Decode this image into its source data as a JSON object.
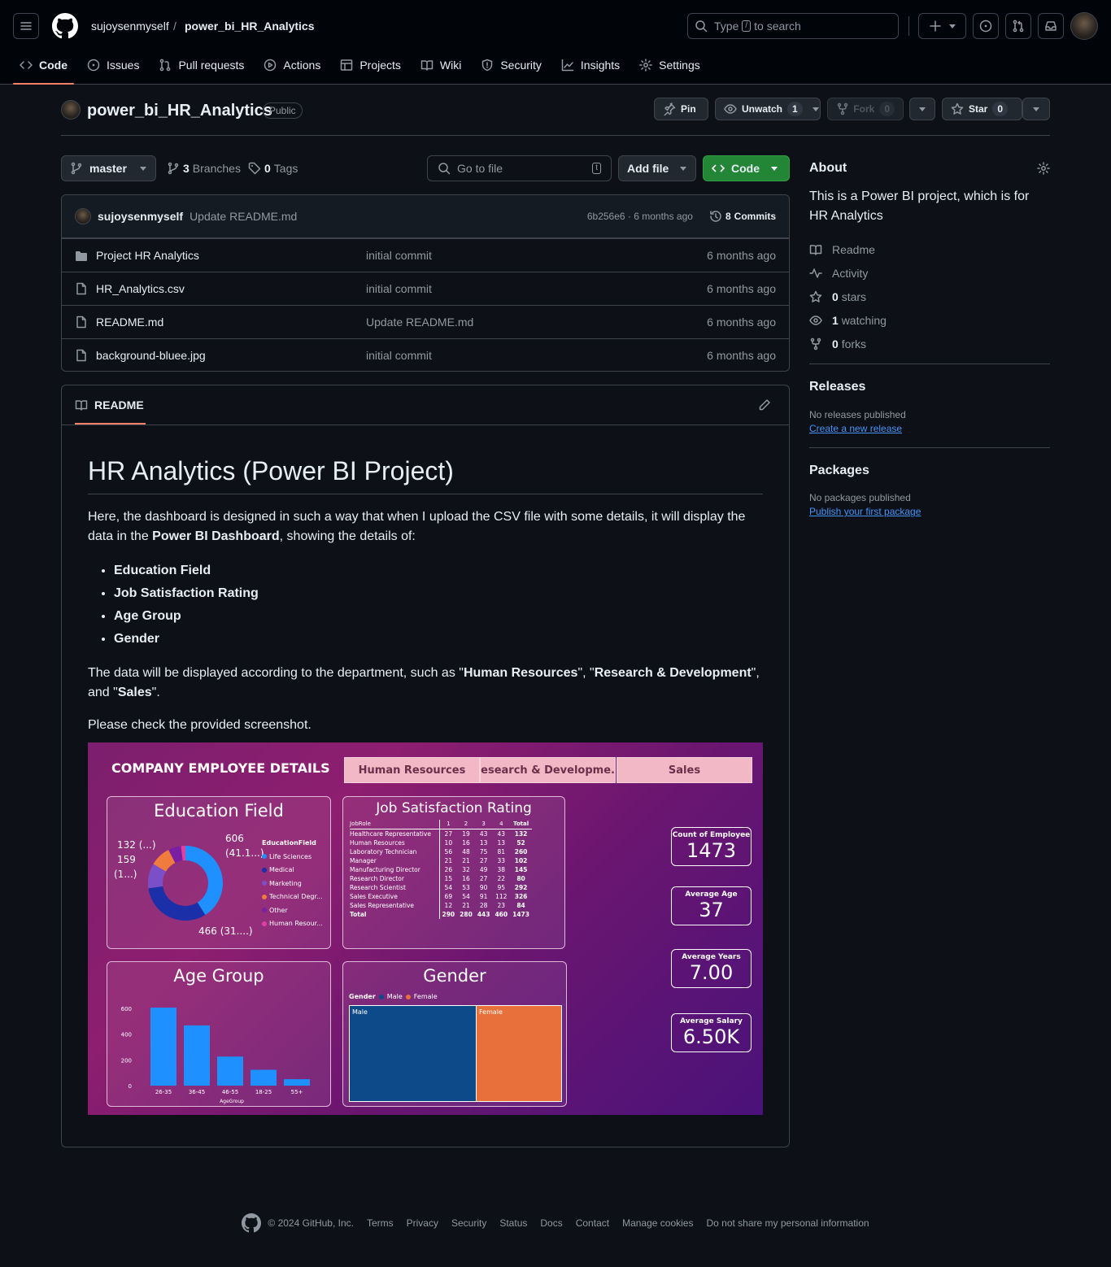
{
  "header": {
    "owner": "sujoysenmyself",
    "repo": "power_bi_HR_Analytics",
    "search_placeholder_a": "Type",
    "search_key": "/",
    "search_placeholder_b": "to search"
  },
  "nav": [
    {
      "label": "Code",
      "icon": "code-icon"
    },
    {
      "label": "Issues",
      "icon": "issue-icon"
    },
    {
      "label": "Pull requests",
      "icon": "pull-request-icon"
    },
    {
      "label": "Actions",
      "icon": "play-icon"
    },
    {
      "label": "Projects",
      "icon": "table-icon"
    },
    {
      "label": "Wiki",
      "icon": "book-icon"
    },
    {
      "label": "Security",
      "icon": "shield-icon"
    },
    {
      "label": "Insights",
      "icon": "graph-icon"
    },
    {
      "label": "Settings",
      "icon": "gear-icon"
    }
  ],
  "repo": {
    "name": "power_bi_HR_Analytics",
    "visibility": "Public",
    "pin": "Pin",
    "unwatch": "Unwatch",
    "watch_count": "1",
    "fork": "Fork",
    "fork_count": "0",
    "star": "Star",
    "star_count": "0"
  },
  "toolbar": {
    "branch": "master",
    "branches_count": "3",
    "branches_label": "Branches",
    "tags_count": "0",
    "tags_label": "Tags",
    "goto_placeholder": "Go to file",
    "goto_key": "t",
    "add_file": "Add file",
    "code": "Code"
  },
  "commit": {
    "author": "sujoysenmyself",
    "message": "Update README.md",
    "hash_time": "6b256e6 · 6 months ago",
    "commits_count": "8",
    "commits_label": "Commits"
  },
  "files": [
    {
      "name": "Project HR Analytics",
      "type": "folder",
      "message": "initial commit",
      "age": "6 months ago"
    },
    {
      "name": "HR_Analytics.csv",
      "type": "file",
      "message": "initial commit",
      "age": "6 months ago"
    },
    {
      "name": "README.md",
      "type": "file",
      "message": "Update README.md",
      "age": "6 months ago"
    },
    {
      "name": "background-bluee.jpg",
      "type": "file",
      "message": "initial commit",
      "age": "6 months ago"
    }
  ],
  "readme": {
    "tab": "README",
    "title": "HR Analytics (Power BI Project)",
    "p1_a": "Here, the dashboard is designed in such a way that when I upload the CSV file with some details, it will display the data in the ",
    "p1_b": "Power BI Dashboard",
    "p1_c": ", showing the details of:",
    "bullets": [
      "Education Field",
      "Job Satisfaction Rating",
      "Age Group",
      "Gender"
    ],
    "p2_a": "The data will be displayed according to the department, such as \"",
    "p2_b": "Human Resources",
    "p2_c": "\", \"",
    "p2_d": "Research & Development",
    "p2_e": "\", and \"",
    "p2_f": "Sales",
    "p2_g": "\".",
    "p3": "Please check the provided screenshot."
  },
  "dashboard": {
    "heading": "COMPANY EMPLOYEE DETAILS",
    "tabs": [
      "Human Resources",
      "Research & Developme...",
      "Sales"
    ],
    "education": {
      "title": "Education Field",
      "legend_title": "EducationField",
      "legend": [
        {
          "label": "Life Sciences",
          "color": "#1e90ff"
        },
        {
          "label": "Medical",
          "color": "#1a2fa8"
        },
        {
          "label": "Marketing",
          "color": "#7b4fc8"
        },
        {
          "label": "Technical Degr...",
          "color": "#f07b3f"
        },
        {
          "label": "Other",
          "color": "#7b1fa2"
        },
        {
          "label": "Human Resour...",
          "color": "#e040a0"
        }
      ],
      "labels": {
        "a": "606",
        "b": "(41.1...)",
        "c": "466 (31....)",
        "d": "132 (...)",
        "e": "159",
        "f": "(1...)"
      },
      "slices": [
        606,
        466,
        159,
        132,
        82,
        28
      ]
    },
    "job": {
      "title": "Job Satisfaction Rating",
      "header": [
        "JobRole",
        "1",
        "2",
        "3",
        "4",
        "Total"
      ],
      "rows": [
        [
          "Healthcare Representative",
          "27",
          "19",
          "43",
          "43",
          "132"
        ],
        [
          "Human Resources",
          "10",
          "16",
          "13",
          "13",
          "52"
        ],
        [
          "Laboratory Technician",
          "56",
          "48",
          "75",
          "81",
          "260"
        ],
        [
          "Manager",
          "21",
          "21",
          "27",
          "33",
          "102"
        ],
        [
          "Manufacturing Director",
          "26",
          "32",
          "49",
          "38",
          "145"
        ],
        [
          "Research Director",
          "15",
          "16",
          "27",
          "22",
          "80"
        ],
        [
          "Research Scientist",
          "54",
          "53",
          "90",
          "95",
          "292"
        ],
        [
          "Sales Executive",
          "69",
          "54",
          "91",
          "112",
          "326"
        ],
        [
          "Sales Representative",
          "12",
          "21",
          "28",
          "23",
          "84"
        ],
        [
          "Total",
          "290",
          "280",
          "443",
          "460",
          "1473"
        ]
      ]
    },
    "age": {
      "title": "Age Group",
      "xlabel": "AgeGroup",
      "yticks": [
        "600",
        "400",
        "200",
        "0"
      ],
      "categories": [
        "26-35",
        "36-45",
        "46-55",
        "18-25",
        "55+"
      ],
      "values": [
        606,
        468,
        226,
        123,
        50
      ]
    },
    "gender": {
      "title": "Gender",
      "legend_title": "Gender",
      "legend": [
        {
          "label": "Male",
          "color": "#0d4a8a"
        },
        {
          "label": "Female",
          "color": "#e8703a"
        }
      ],
      "male_label": "Male",
      "female_label": "Female",
      "male_share": 0.6
    },
    "kpis": [
      {
        "label": "Count of Employee",
        "value": "1473"
      },
      {
        "label": "Average Age",
        "value": "37"
      },
      {
        "label": "Average Years",
        "value": "7.00"
      },
      {
        "label": "Average Salary",
        "value": "6.50K"
      }
    ]
  },
  "sidebar": {
    "about": "About",
    "description": "This is a Power BI project, which is for HR Analytics",
    "items": [
      {
        "icon": "book-icon",
        "count": "",
        "label": "Readme"
      },
      {
        "icon": "pulse-icon",
        "count": "",
        "label": "Activity"
      },
      {
        "icon": "star-icon",
        "count": "0",
        "label": "stars"
      },
      {
        "icon": "eye-icon",
        "count": "1",
        "label": "watching"
      },
      {
        "icon": "fork-icon",
        "count": "0",
        "label": "forks"
      }
    ],
    "releases": "Releases",
    "no_releases": "No releases published",
    "create_release": "Create a new release",
    "packages": "Packages",
    "no_packages": "No packages published",
    "publish_package": "Publish your first package"
  },
  "footer": {
    "copyright": "© 2024 GitHub, Inc.",
    "links": [
      "Terms",
      "Privacy",
      "Security",
      "Status",
      "Docs",
      "Contact",
      "Manage cookies",
      "Do not share my personal information"
    ]
  }
}
